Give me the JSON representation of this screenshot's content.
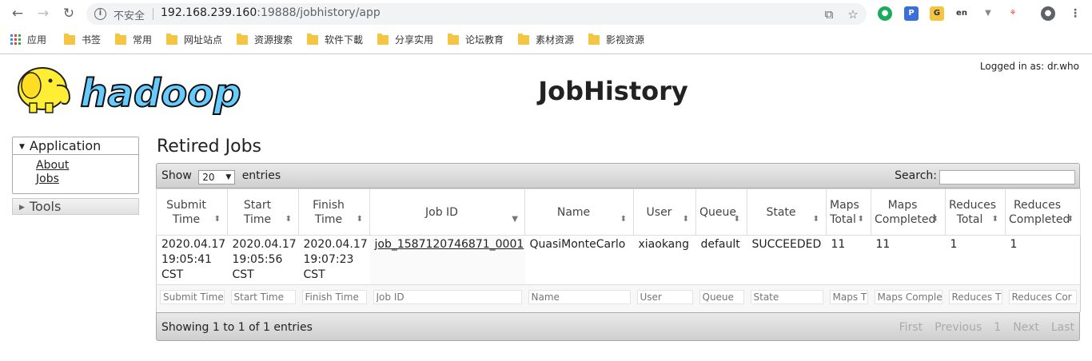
{
  "browser": {
    "insecure_label": "不安全",
    "url_host": "192.168.239.160",
    "url_rest": ":19888/jobhistory/app",
    "bookmarks": [
      {
        "label": "应用",
        "icon": "apps-icon"
      },
      {
        "label": "书签",
        "icon": "folder-icon"
      },
      {
        "label": "常用",
        "icon": "folder-icon"
      },
      {
        "label": "网址站点",
        "icon": "folder-icon"
      },
      {
        "label": "资源搜索",
        "icon": "folder-icon"
      },
      {
        "label": "软件下載",
        "icon": "folder-icon"
      },
      {
        "label": "分享实用",
        "icon": "folder-icon"
      },
      {
        "label": "论坛教育",
        "icon": "folder-icon"
      },
      {
        "label": "素材资源",
        "icon": "folder-icon"
      },
      {
        "label": "影视资源",
        "icon": "folder-icon"
      }
    ]
  },
  "header": {
    "logo_text": "hadoop",
    "title": "JobHistory",
    "logged_in": "Logged in as: dr.who"
  },
  "nav": {
    "application_label": "Application",
    "links": [
      "About",
      "Jobs"
    ],
    "tools_label": "Tools"
  },
  "main": {
    "section_title": "Retired Jobs",
    "show_label": "Show",
    "page_length": "20",
    "entries_label": "entries",
    "search_label": "Search:",
    "columns": [
      "Submit Time",
      "Start Time",
      "Finish Time",
      "Job ID",
      "Name",
      "User",
      "Queue",
      "State",
      "Maps Total",
      "Maps Completed",
      "Reduces Total",
      "Reduces Completed"
    ],
    "rows": [
      {
        "submit_time": "2020.04.17 19:05:41 CST",
        "start_time": "2020.04.17 19:05:56 CST",
        "finish_time": "2020.04.17 19:07:23 CST",
        "job_id": "job_1587120746871_0001",
        "name": "QuasiMonteCarlo",
        "user": "xiaokang",
        "queue": "default",
        "state": "SUCCEEDED",
        "maps_total": "11",
        "maps_completed": "11",
        "reduces_total": "1",
        "reduces_completed": "1"
      }
    ],
    "filter_placeholders": [
      "Submit Time",
      "Start Time",
      "Finish Time",
      "Job ID",
      "Name",
      "User",
      "Queue",
      "State",
      "Maps T",
      "Maps Comple",
      "Reduces T",
      "Reduces Cor"
    ],
    "info": "Showing 1 to 1 of 1 entries",
    "pager": {
      "first": "First",
      "previous": "Previous",
      "page": "1",
      "next": "Next",
      "last": "Last"
    }
  },
  "colors": {
    "accent": "#4285f4",
    "logo_fill": "#66ccff",
    "elephant": "#ffee33"
  }
}
